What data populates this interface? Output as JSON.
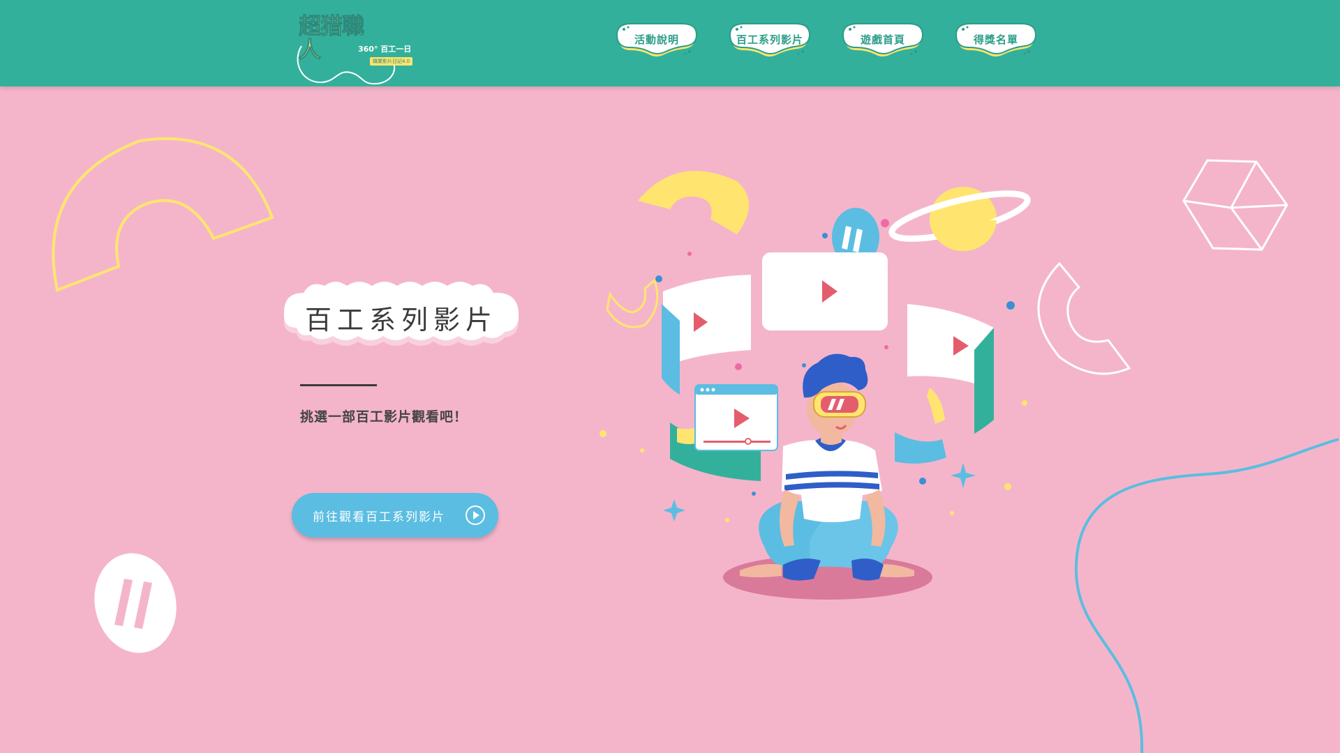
{
  "header": {
    "logo": {
      "main_text": "超猎職人",
      "sub_text": "360° 百工一日",
      "tag_text": "職業影片日記4.0"
    },
    "nav": [
      {
        "label": "活動說明"
      },
      {
        "label": "百工系列影片"
      },
      {
        "label": "遊戲首頁"
      },
      {
        "label": "得獎名單"
      }
    ]
  },
  "hero": {
    "title": "百工系列影片",
    "subtitle": "挑選一部百工影片觀看吧！",
    "cta_label": "前往觀看百工系列影片"
  },
  "colors": {
    "header_bg": "#33b09b",
    "page_bg": "#f4b5ca",
    "accent_yellow": "#ffe56f",
    "accent_blue": "#5bbde1",
    "play_red": "#e45d6c"
  },
  "icons": {
    "cta_icon": "play-circle-icon",
    "hero_icon": "vr-viewer-illustration"
  }
}
